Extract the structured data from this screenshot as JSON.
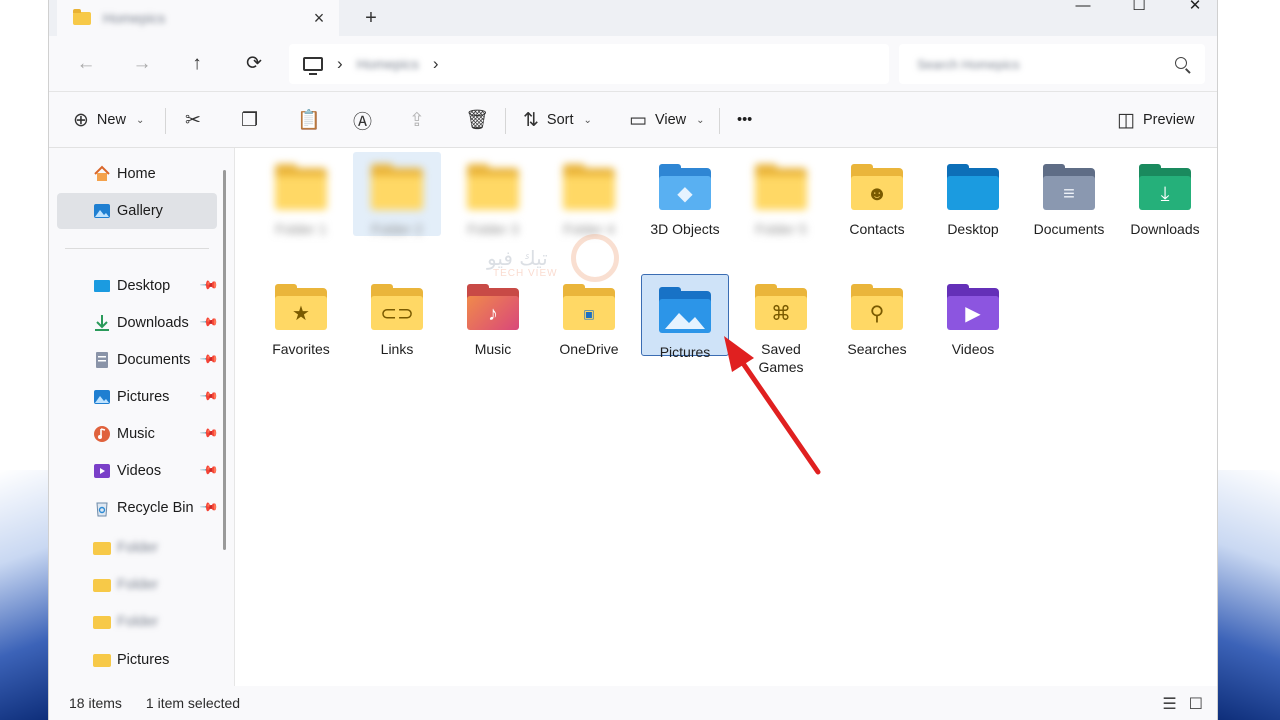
{
  "tab": {
    "title": "Homepics"
  },
  "window": {
    "minimize": "—",
    "maximize": "☐",
    "close": "✕"
  },
  "nav": {
    "back": "←",
    "forward": "→",
    "up": "↑",
    "refresh": "⟳"
  },
  "address": {
    "path_blurred": "Homepics",
    "chevron": "›"
  },
  "search": {
    "placeholder": "Search Homepics"
  },
  "toolbar": {
    "new_label": "New",
    "sort_label": "Sort",
    "view_label": "View",
    "more_label": "•••",
    "preview_label": "Preview"
  },
  "sidebar": {
    "home": "Home",
    "gallery": "Gallery",
    "items": [
      {
        "label": "Desktop",
        "icon": "desktop-icon"
      },
      {
        "label": "Downloads",
        "icon": "downloads-icon"
      },
      {
        "label": "Documents",
        "icon": "documents-icon"
      },
      {
        "label": "Pictures",
        "icon": "pictures-icon"
      },
      {
        "label": "Music",
        "icon": "music-icon"
      },
      {
        "label": "Videos",
        "icon": "videos-icon"
      },
      {
        "label": "Recycle Bin",
        "icon": "recycle-bin-icon"
      }
    ],
    "blurred_folders": [
      "Folder",
      "Folder",
      "Folder"
    ],
    "last_folder": "Pictures"
  },
  "grid": {
    "blurred": [
      "Folder 1",
      "Folder 2",
      "Folder 3",
      "Folder 4",
      "Folder 5"
    ],
    "row1": [
      "3D Objects",
      "Contacts",
      "Desktop",
      "Documents",
      "Downloads"
    ],
    "row2": [
      "Favorites",
      "Links",
      "Music",
      "OneDrive",
      "Pictures",
      "Saved Games",
      "Searches",
      "Videos"
    ]
  },
  "watermark": {
    "text": "تيك فيو",
    "sub": "TECH VIEW"
  },
  "status": {
    "count": "18 items",
    "selection": "1 item selected"
  },
  "colors": {
    "folder": "#ffd865",
    "selection": "#cfe3f8",
    "arrow": "#e02020"
  }
}
